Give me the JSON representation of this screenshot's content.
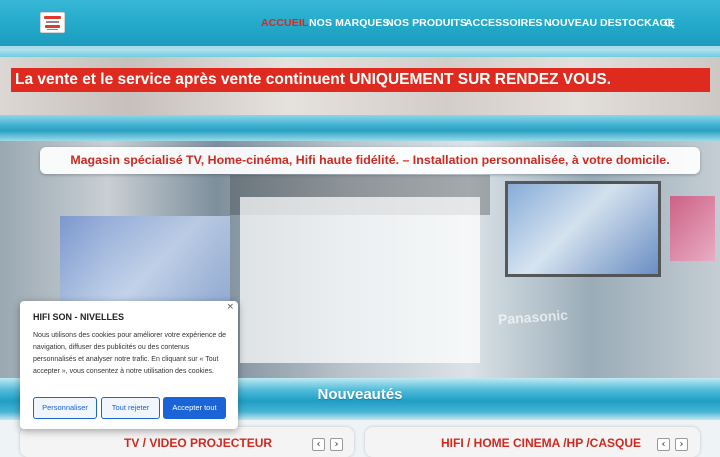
{
  "header": {
    "logo": "hifi-son-logo",
    "nav": [
      {
        "label": "ACCUEIL",
        "active": true
      },
      {
        "label": "NOS MARQUES"
      },
      {
        "label": "NOS PRODUITS"
      },
      {
        "label": "ACCESSOIRES",
        "has_dropdown": true
      },
      {
        "label": "NOUVEAU"
      },
      {
        "label": "DESTOCKAGE"
      }
    ],
    "search_icon": "search-icon"
  },
  "hero": {
    "notice": "La vente et le service après vente continuent UNIQUEMENT SUR RENDEZ VOUS.",
    "tagline": "Magasin spécialisé TV, Home-cinéma, Hifi haute fidélité. – Installation personnalisée, à votre domicile."
  },
  "nouveautes": {
    "heading": "Nouveautés",
    "boxes": [
      {
        "title": "TV / VIDEO PROJECTEUR",
        "prev": "‹",
        "next": "›"
      },
      {
        "title": "HIFI / HOME CINEMA /HP /CASQUE",
        "prev": "‹",
        "next": "›"
      }
    ]
  },
  "cookie": {
    "close": "×",
    "title": "HIFI SON - NIVELLES",
    "text": "Nous utilisons des cookies pour améliorer votre expérience de navigation, diffuser des publicités ou des contenus personnalisés et analyser notre trafic. En cliquant sur « Tout accepter », vous consentez à notre utilisation des cookies.",
    "btn_preferences": "Personnaliser",
    "btn_reject": "Tout rejeter",
    "btn_accept": "Accepter tout"
  },
  "colors": {
    "header": "#23a9c9",
    "accent_red": "#df2b1f",
    "button_blue": "#1a64d8"
  }
}
